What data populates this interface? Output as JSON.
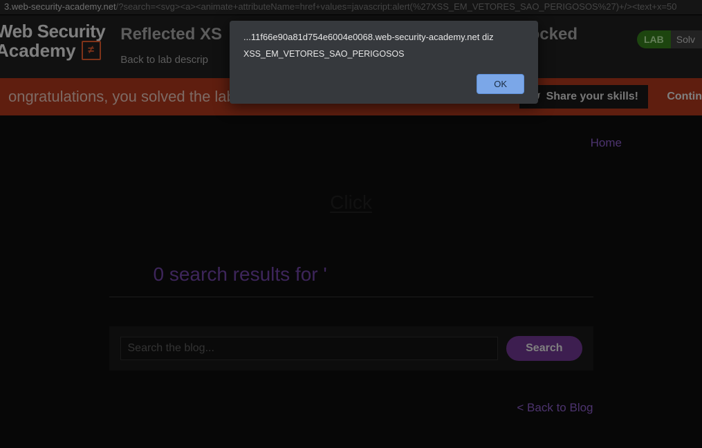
{
  "address_bar": {
    "domain": "3.web-security-academy.net",
    "path": "/?search=<svg><a><animate+attributeName=href+values=javascript:alert(%27XSS_EM_VETORES_SAO_PERIGOSOS%27)+/><text+x=50"
  },
  "header": {
    "logo_line1": "Web Security",
    "logo_line2": "Academy",
    "logo_symbol": "≠",
    "lab_title_visible_left": "Reflected XS",
    "lab_title_visible_right": "blocked",
    "back_link": "Back to lab descrip",
    "lab_badge": "LAB",
    "solved_label": "Solv"
  },
  "banner": {
    "congrats_text": "ongratulations, you solved the lab!",
    "share_label": "Share your skills!",
    "continue_label": "Contin"
  },
  "nav": {
    "home": "Home"
  },
  "content": {
    "click_text": "Click",
    "search_results_heading": "0 search results for '",
    "search_placeholder": "Search the blog...",
    "search_button": "Search",
    "back_to_blog": "< Back to Blog"
  },
  "alert": {
    "origin": "...11f66e90a81d754e6004e0068.web-security-academy.net diz",
    "message": "XSS_EM_VETORES_SAO_PERIGOSOS",
    "ok_label": "OK"
  }
}
